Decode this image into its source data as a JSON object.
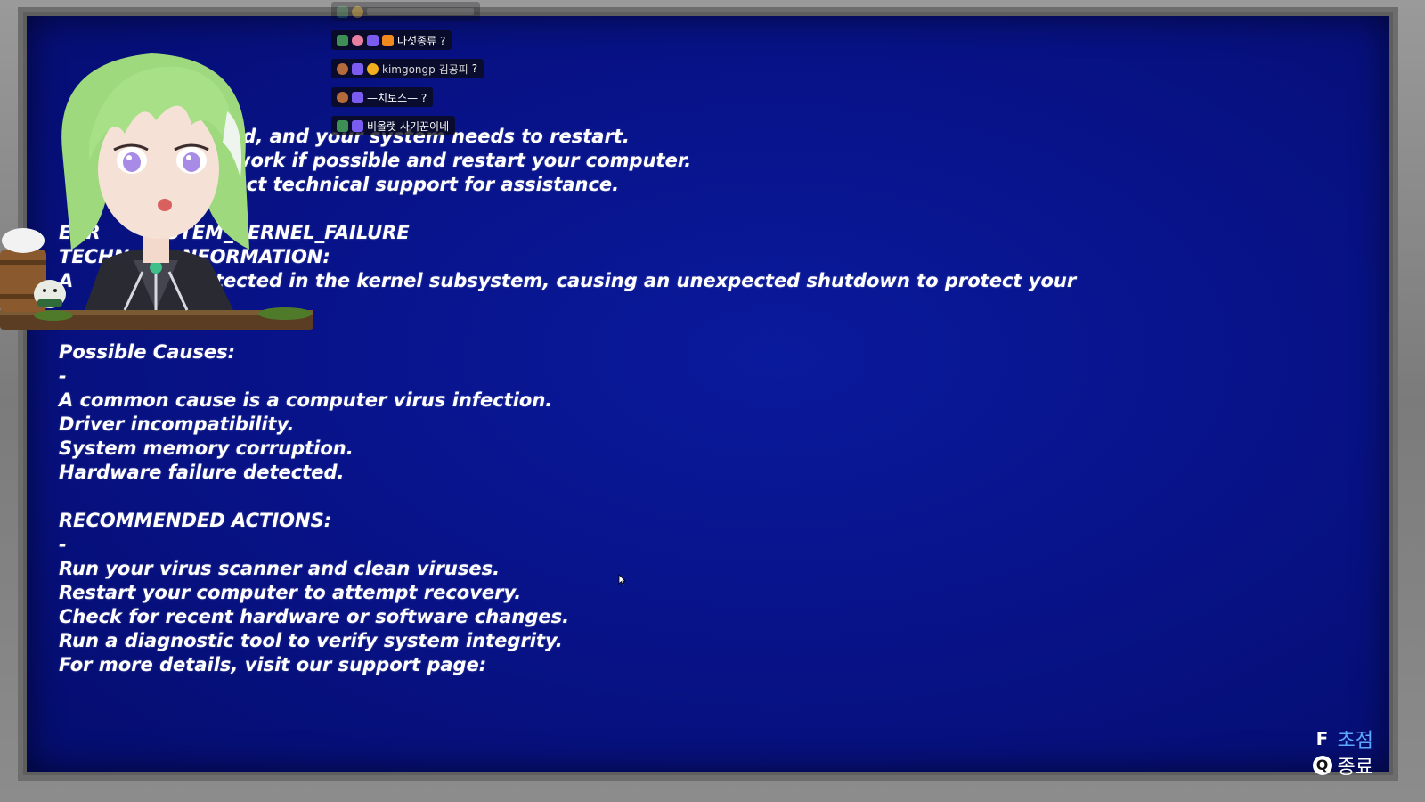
{
  "bsod": {
    "lines": [
      "                  ccurred, and your system needs to restart.",
      "                  aved work if possible and restart your computer.",
      "                s, contact technical support for assistance."
    ],
    "error_line": "ERR        YSTEM_KERNEL_FAILURE",
    "tech_line": "TECHN        NFORMATION:",
    "tech_detail": "A               s detected in the kernel subsystem, causing an unexpected shutdown to protect your",
    "causes_title": "Possible Causes:",
    "causes_dash": "-",
    "causes": [
      "A common cause is a computer virus infection.",
      "Driver incompatibility.",
      "System memory corruption.",
      "Hardware failure detected."
    ],
    "actions_title": "RECOMMENDED ACTIONS:",
    "actions_dash": "-",
    "actions": [
      "Run your virus scanner and clean viruses.",
      "Restart your computer to attempt recovery.",
      "Check for recent hardware or software changes.",
      "Run a diagnostic tool to verify system integrity.",
      "For more details, visit our support page:"
    ]
  },
  "chat": [
    {
      "user": "",
      "message": "다섯종류 ?"
    },
    {
      "user": "kimgongp 김공피",
      "message": "?"
    },
    {
      "user": "",
      "message": "—치토스— ?"
    },
    {
      "user": "",
      "message": "비올랫 사기꾼이네"
    }
  ],
  "hints": {
    "focus_key": "F",
    "focus_label": "초점",
    "quit_key": "Q",
    "quit_label": "종료"
  },
  "colors": {
    "screen": "#08138a",
    "bezel": "#7f7f7f",
    "accent_hint": "#5fa8ff"
  }
}
